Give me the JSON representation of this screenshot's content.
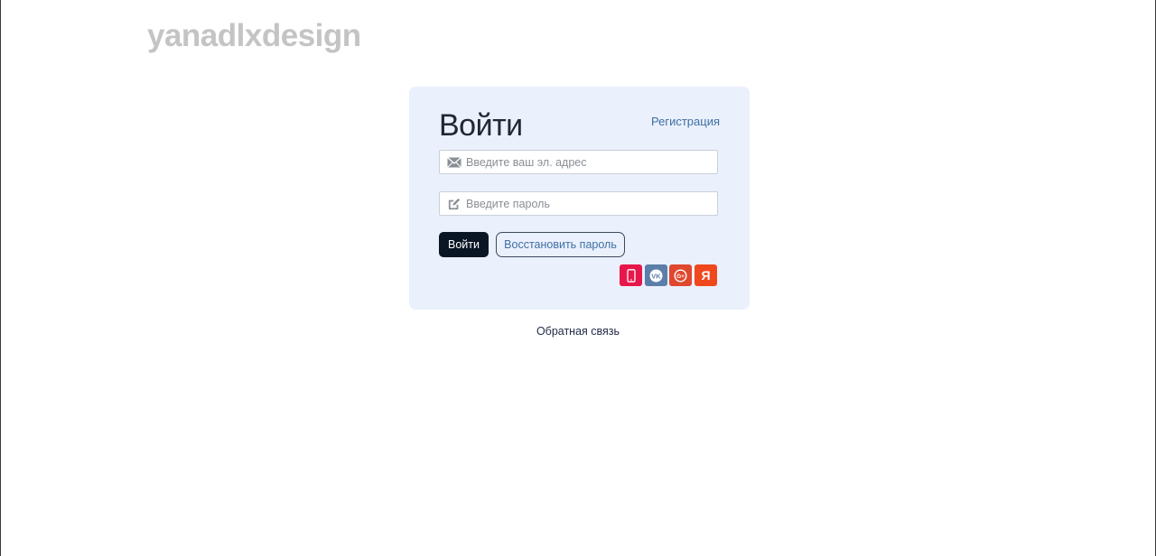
{
  "brand": {
    "logo_text": "yanadlxdesign"
  },
  "login_card": {
    "title": "Войти",
    "register_link": "Регистрация",
    "email_field": {
      "placeholder": "Введите ваш эл. адрес",
      "value": ""
    },
    "password_field": {
      "placeholder": "Введите пароль",
      "value": ""
    },
    "login_button": "Войти",
    "restore_button": "Восстановить пароль",
    "social_logins": [
      {
        "icon": "phone-icon",
        "color": "#e8174b"
      },
      {
        "icon": "vk-icon",
        "label": "VK",
        "color": "#5a7ea8"
      },
      {
        "icon": "google-plus-icon",
        "label": "G+",
        "color": "#e0472f"
      },
      {
        "icon": "yandex-icon",
        "label": "Я",
        "color": "#f0481d"
      }
    ]
  },
  "footer": {
    "feedback_link": "Обратная связь"
  },
  "colors": {
    "card_background": "#eaf0fc",
    "primary_button": "#0b1624",
    "link": "#3f6fa3",
    "logo": "#c4c4c4"
  }
}
